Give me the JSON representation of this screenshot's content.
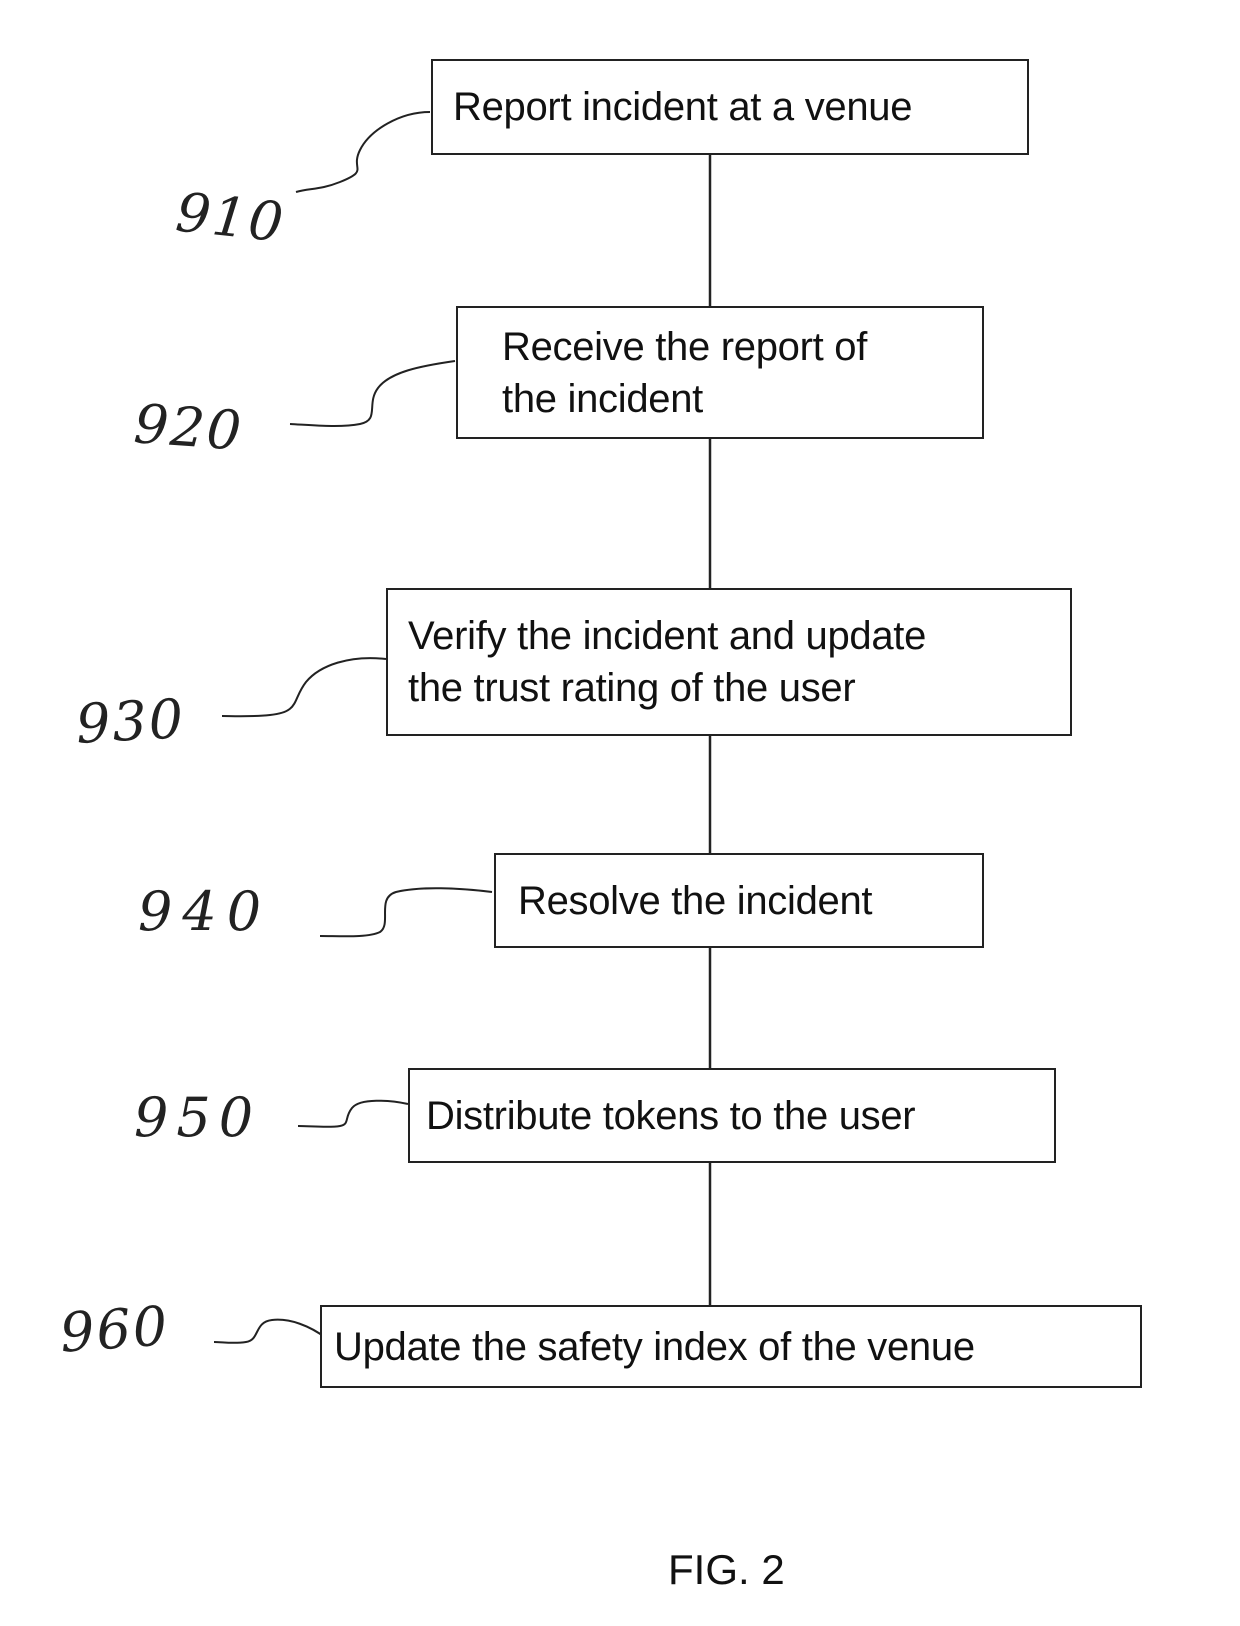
{
  "figure": {
    "caption": "FIG. 2",
    "steps": [
      {
        "ref": "910",
        "text": "Report incident at a venue"
      },
      {
        "ref": "920",
        "text": "Receive the report of the incident",
        "lines": [
          "Receive the report of",
          "the incident"
        ]
      },
      {
        "ref": "930",
        "text": "Verify the incident and update the trust rating of the user",
        "lines": [
          "Verify the incident and update",
          "the trust rating of the user"
        ]
      },
      {
        "ref": "940",
        "text": "Resolve the incident"
      },
      {
        "ref": "950",
        "text": "Distribute tokens to the user"
      },
      {
        "ref": "960",
        "text": "Update the safety index of the venue"
      }
    ]
  }
}
